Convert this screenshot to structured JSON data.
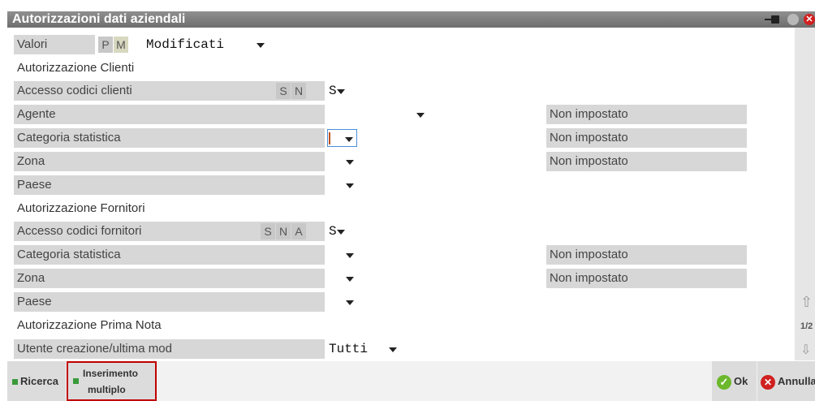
{
  "window": {
    "title": "Autorizzazioni dati aziendali"
  },
  "valori": {
    "label": "Valori",
    "options": [
      "P",
      "M"
    ],
    "selected": "M",
    "value": "Modificati"
  },
  "clienti": {
    "section": "Autorizzazione Clienti",
    "accesso": {
      "label": "Accesso codici clienti",
      "options": [
        "S",
        "N"
      ],
      "value": "S"
    },
    "rows": [
      {
        "label": "Agente",
        "value": "",
        "status": "Non impostato"
      },
      {
        "label": "Categoria statistica",
        "value": "",
        "status": "Non impostato"
      },
      {
        "label": "Zona",
        "value": "",
        "status": "Non impostato"
      },
      {
        "label": "Paese",
        "value": ""
      }
    ]
  },
  "fornitori": {
    "section": "Autorizzazione Fornitori",
    "accesso": {
      "label": "Accesso codici fornitori",
      "options": [
        "S",
        "N",
        "A"
      ],
      "value": "S"
    },
    "rows": [
      {
        "label": "Categoria statistica",
        "value": "",
        "status": "Non impostato"
      },
      {
        "label": "Zona",
        "value": "",
        "status": "Non impostato"
      },
      {
        "label": "Paese",
        "value": ""
      }
    ]
  },
  "primanota": {
    "section": "Autorizzazione Prima Nota",
    "utente": {
      "label": "Utente creazione/ultima mod",
      "value": "Tutti"
    }
  },
  "scroll": {
    "page": "1/2"
  },
  "footer": {
    "ricerca": "Ricerca",
    "inserimento_line1": "Inserimento",
    "inserimento_line2": "multiplo",
    "ok": "Ok",
    "annulla": "Annulla"
  }
}
